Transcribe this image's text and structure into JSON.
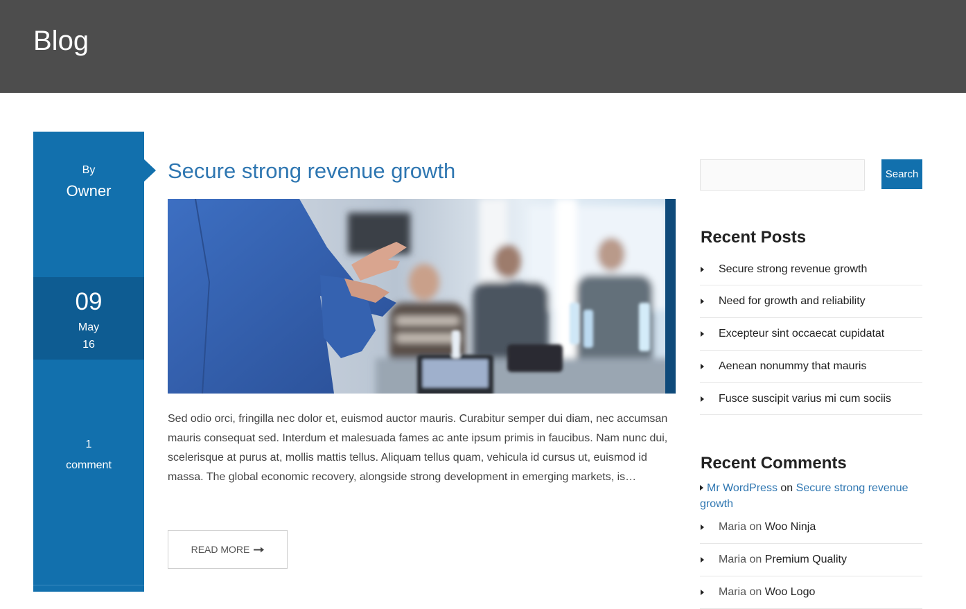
{
  "header": {
    "title": "Blog"
  },
  "post": {
    "by_label": "By",
    "author": "Owner",
    "date": {
      "day": "09",
      "month": "May",
      "year": "16"
    },
    "comments": {
      "count": "1",
      "label": "comment"
    },
    "title": "Secure strong revenue growth",
    "excerpt": "Sed odio orci, fringilla nec dolor et, euismod auctor mauris. Curabitur semper dui diam, nec accumsan mauris consequat sed. Interdum et malesuada fames ac ante ipsum primis in faucibus. Nam nunc dui, scelerisque at purus at, mollis mattis tellus. Aliquam tellus quam, vehicula id cursus ut, euismod id massa. The global economic recovery, alongside strong development in emerging markets, is…",
    "read_more": "READ MORE",
    "read_more_icon": "arrow-right-icon"
  },
  "sidebar": {
    "search": {
      "placeholder": "",
      "button": "Search"
    },
    "recent_posts": {
      "title": "Recent Posts",
      "items": [
        "Secure strong revenue growth",
        "Need for growth and reliability",
        "Excepteur sint occaecat cupidatat",
        "Aenean nonummy that mauris",
        "Fusce suscipit varius mi cum sociis"
      ]
    },
    "recent_comments": {
      "title": "Recent Comments",
      "on_word": "on",
      "items": [
        {
          "author": "Mr WordPress",
          "post": "Secure strong revenue growth"
        },
        {
          "author": "Maria",
          "post": "Woo Ninja"
        },
        {
          "author": "Maria",
          "post": "Premium Quality"
        },
        {
          "author": "Maria",
          "post": "Woo Logo"
        }
      ]
    }
  },
  "colors": {
    "header_bg": "#4d4d4d",
    "accent": "#1270ad",
    "date_bg": "#0e5c92",
    "link": "#2e76b1"
  }
}
